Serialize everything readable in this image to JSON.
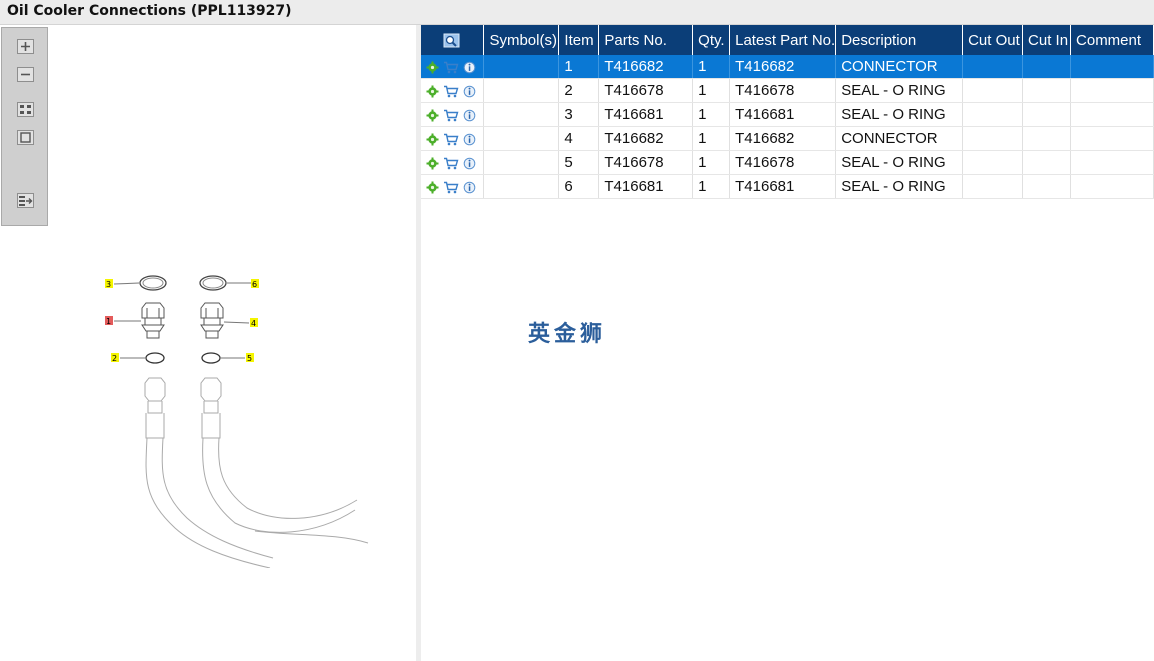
{
  "window": {
    "title": "Oil Cooler Connections (PPL113927)"
  },
  "toolbar": {
    "buttons": [
      {
        "name": "zoom-in",
        "icon": "zoom-in-icon"
      },
      {
        "name": "zoom-out",
        "icon": "zoom-out-icon"
      },
      {
        "name": "fit-view",
        "icon": "fit-view-icon"
      },
      {
        "name": "actual-size",
        "icon": "actual-size-icon"
      },
      {
        "name": "export",
        "icon": "export-icon"
      }
    ]
  },
  "callouts": [
    "3",
    "6",
    "1",
    "4",
    "2",
    "5"
  ],
  "table": {
    "columns": [
      "",
      "Symbol(s)",
      "Item",
      "Parts No.",
      "Qty.",
      "Latest Part No.",
      "Description",
      "Cut Out",
      "Cut In",
      "Comment"
    ],
    "selected_row": 0,
    "rows": [
      {
        "symbols": "",
        "item": "1",
        "part_no": "T416682",
        "qty": "1",
        "latest": "T416682",
        "description": "CONNECTOR",
        "cut_out": "",
        "cut_in": "",
        "comment": ""
      },
      {
        "symbols": "",
        "item": "2",
        "part_no": "T416678",
        "qty": "1",
        "latest": "T416678",
        "description": "SEAL - O RING",
        "cut_out": "",
        "cut_in": "",
        "comment": ""
      },
      {
        "symbols": "",
        "item": "3",
        "part_no": "T416681",
        "qty": "1",
        "latest": "T416681",
        "description": "SEAL - O RING",
        "cut_out": "",
        "cut_in": "",
        "comment": ""
      },
      {
        "symbols": "",
        "item": "4",
        "part_no": "T416682",
        "qty": "1",
        "latest": "T416682",
        "description": "CONNECTOR",
        "cut_out": "",
        "cut_in": "",
        "comment": ""
      },
      {
        "symbols": "",
        "item": "5",
        "part_no": "T416678",
        "qty": "1",
        "latest": "T416678",
        "description": "SEAL - O RING",
        "cut_out": "",
        "cut_in": "",
        "comment": ""
      },
      {
        "symbols": "",
        "item": "6",
        "part_no": "T416681",
        "qty": "1",
        "latest": "T416681",
        "description": "SEAL - O RING",
        "cut_out": "",
        "cut_in": "",
        "comment": ""
      }
    ]
  },
  "watermark": "英金狮",
  "colors": {
    "header": "#0b3e78",
    "selected": "#0a78d4",
    "callout_yellow": "#f5f500",
    "callout_red": "#e45b5b"
  }
}
